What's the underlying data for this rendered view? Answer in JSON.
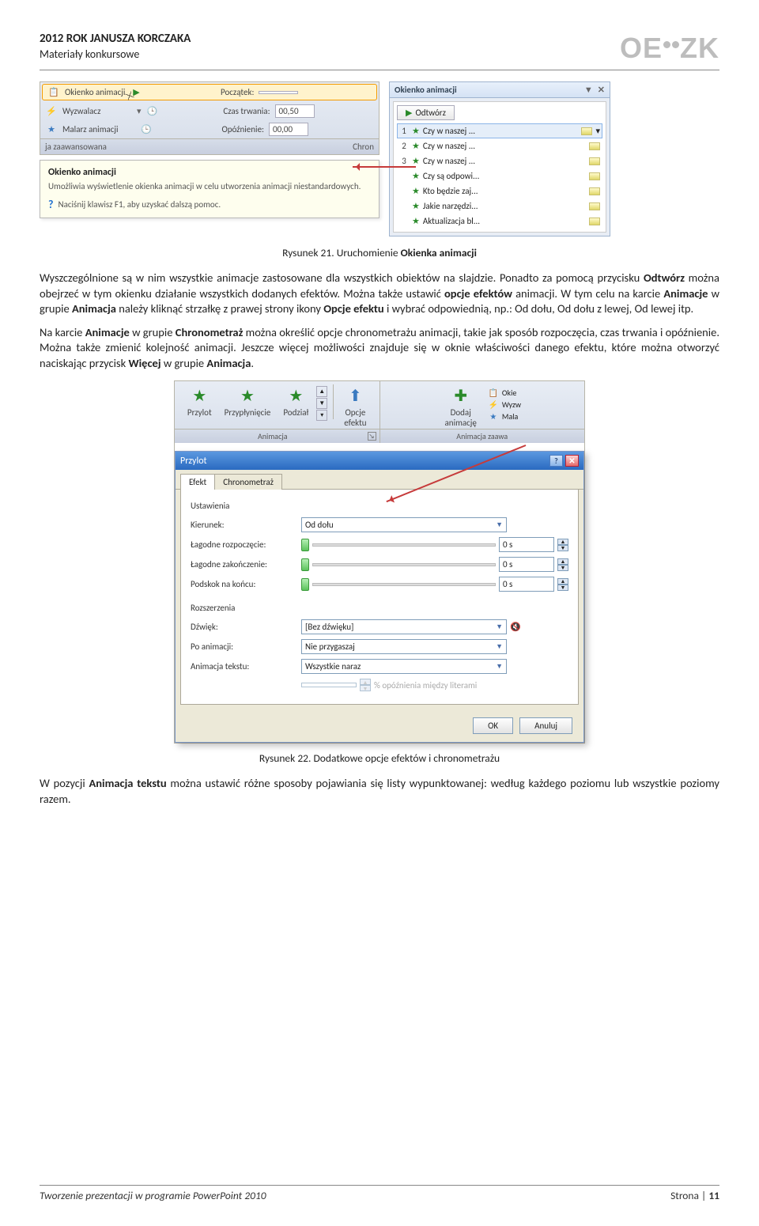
{
  "header": {
    "title": "2012 ROK JANUSZA KORCZAKA",
    "subtitle": "Materiały konkursowe",
    "logo": "OE  ZK"
  },
  "ribbon": {
    "anim_pane_btn": "Okienko animacji",
    "trigger_btn": "Wyzwalacz",
    "painter_btn": "Malarz animacji",
    "group_label": "ja zaawansowana",
    "start_lbl": "Początek:",
    "duration_lbl": "Czas trwania:",
    "duration_val": "00,50",
    "delay_lbl": "Opóźnienie:",
    "delay_val": "00,00",
    "group_label_right": "Chron"
  },
  "tooltip": {
    "title": "Okienko animacji",
    "body": "Umożliwia wyświetlenie okienka animacji w celu utworzenia animacji niestandardowych.",
    "help": "Naciśnij klawisz F1, aby uzyskać dalszą pomoc."
  },
  "anim_pane": {
    "title": "Okienko animacji",
    "play": "Odtwórz",
    "items": [
      {
        "num": "1",
        "txt": "Czy w naszej ..."
      },
      {
        "num": "2",
        "txt": "Czy w naszej ..."
      },
      {
        "num": "3",
        "txt": "Czy w naszej ..."
      },
      {
        "num": "",
        "txt": "Czy są odpowi..."
      },
      {
        "num": "",
        "txt": "Kto będzie zaj..."
      },
      {
        "num": "",
        "txt": "Jakie narzędzi..."
      },
      {
        "num": "",
        "txt": "Aktualizacja bl..."
      }
    ]
  },
  "caption1_pre": "Rysunek 21. Uruchomienie ",
  "caption1_bold": "Okienka animacji",
  "para1": {
    "t1": "Wyszczególnione są w nim wszystkie animacje zastosowane dla wszystkich obiektów na slajdzie. Ponadto za pomocą przycisku ",
    "b1": "Odtwórz",
    "t2": " można obejrzeć w tym okienku działanie wszystkich dodanych efektów. Można także ustawić ",
    "b2": "opcje efektów",
    "t3": " animacji. W tym celu na karcie ",
    "b3": "Animacje",
    "t4": " w grupie ",
    "b4": "Animacja",
    "t5": " należy kliknąć strzałkę z prawej strony ikony ",
    "b5": "Opcje efektu",
    "t6": " i wybrać odpowiednią, np.: Od dołu, Od dołu z lewej, Od lewej itp."
  },
  "para2": {
    "t1": "Na karcie ",
    "b1": "Animacje",
    "t2": " w grupie ",
    "b2": "Chronometraż",
    "t3": " można określić opcje chronometrażu animacji, takie jak sposób rozpoczęcia, czas trwania i opóźnienie. Można także zmienić kolejność animacji. Jeszcze więcej możliwości znajduje się w oknie właściwości danego efektu, które można otworzyć naciskając przycisk ",
    "b3": "Więcej",
    "t4": " w grupie ",
    "b4": "Animacja",
    "t5": "."
  },
  "fig2": {
    "ribbon_items": [
      "Przylot",
      "Przypłynięcie",
      "Podział"
    ],
    "opcje_lbl": "Opcje\nefektu",
    "dodaj_lbl": "Dodaj\nanimację",
    "grp_anim": "Animacja",
    "grp_adv": "Animacja zaawa",
    "r_okie": "Okie",
    "r_wyzw": "Wyzw",
    "r_mala": "Mala"
  },
  "dlg": {
    "title": "Przylot",
    "tab_efekt": "Efekt",
    "tab_chrono": "Chronometraż",
    "settings_lbl": "Ustawienia",
    "kierunek_lbl": "Kierunek:",
    "kierunek_val": "Od dołu",
    "lag_rozp_lbl": "Łagodne rozpoczęcie:",
    "lag_zak_lbl": "Łagodne zakończenie:",
    "podskok_lbl": "Podskok na końcu:",
    "zero_s": "0 s",
    "ext_lbl": "Rozszerzenia",
    "dzwiek_lbl": "Dźwięk:",
    "dzwiek_val": "[Bez dźwięku]",
    "po_anim_lbl": "Po animacji:",
    "po_anim_val": "Nie przygaszaj",
    "anim_txt_lbl": "Animacja tekstu:",
    "anim_txt_val": "Wszystkie naraz",
    "pct_lbl": "% opóźnienia między literami",
    "ok": "OK",
    "cancel": "Anuluj"
  },
  "caption2": "Rysunek 22. Dodatkowe opcje efektów i chronometrażu",
  "para3": {
    "t1": "W pozycji ",
    "b1": "Animacja tekstu",
    "t2": " można ustawić różne sposoby pojawiania się listy wypunktowanej: według każdego poziomu lub wszystkie poziomy razem."
  },
  "footer": {
    "left": "Tworzenie prezentacji w programie PowerPoint 2010",
    "right_lbl": "Strona | ",
    "page": "11"
  }
}
